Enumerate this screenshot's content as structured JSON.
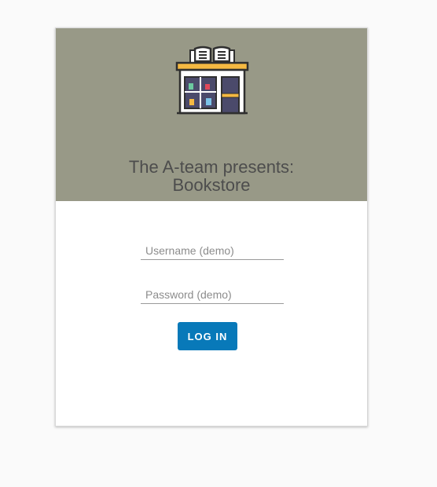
{
  "header": {
    "title_line1": "The A-team presents:",
    "title_line2": "Bookstore",
    "banner_color": "#989987",
    "logo_icon": "bookstore-icon"
  },
  "form": {
    "username_placeholder": "Username (demo)",
    "password_placeholder": "Password (demo)",
    "login_label": "LOG IN",
    "login_color": "#0879b9"
  }
}
